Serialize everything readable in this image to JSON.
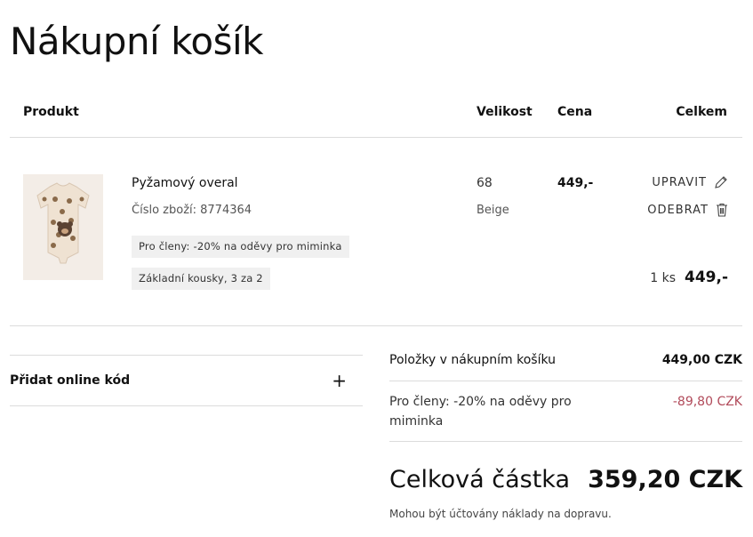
{
  "page": {
    "title": "Nákupní košík"
  },
  "table": {
    "headers": {
      "product": "Produkt",
      "size": "Velikost",
      "price": "Cena",
      "total": "Celkem"
    }
  },
  "item": {
    "name": "Pyžamový overal",
    "product_number": "Číslo zboží: 8774364",
    "tags": [
      "Pro členy: -20% na oděvy pro miminka",
      "Základní kousky, 3 za 2"
    ],
    "size": "68",
    "color": "Beige",
    "price": "449,-",
    "edit_label": "UPRAVIT",
    "remove_label": "ODEBRAT",
    "quantity": "1 ks",
    "line_total": "449,-",
    "thumbnail_icon": "baby-romper-image"
  },
  "promo": {
    "label": "Přidat online kód",
    "expand_symbol": "+"
  },
  "summary": {
    "items_label": "Položky v nákupním košíku",
    "items_value": "449,00 CZK",
    "discount_label": "Pro členy: -20% na oděvy pro miminka",
    "discount_value": "-89,80 CZK",
    "total_label": "Celková částka",
    "total_value": "359,20 CZK",
    "shipping_note": "Mohou být účtovány náklady na dopravu."
  },
  "colors": {
    "discount": "#b14a5a",
    "tag_bg": "#f0f0f0",
    "divider": "#dcdcdc"
  }
}
